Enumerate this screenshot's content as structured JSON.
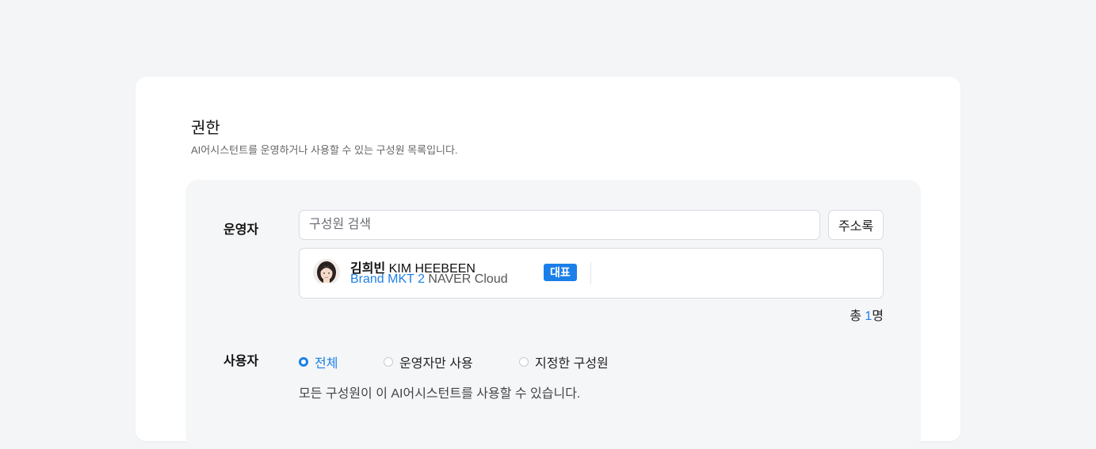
{
  "section": {
    "title": "권한",
    "description": "AI어시스턴트를 운영하거나 사용할 수 있는 구성원 목록입니다."
  },
  "operator": {
    "label": "운영자",
    "search_placeholder": "구성원 검색",
    "address_book_label": "주소록",
    "member": {
      "name_ko": "김희빈",
      "name_en": "KIM HEEBEEN",
      "team": "Brand MKT 2",
      "company": "NAVER Cloud",
      "badge": "대표"
    },
    "total_prefix": "총 ",
    "total_count": "1",
    "total_suffix": "명"
  },
  "user": {
    "label": "사용자",
    "options": [
      {
        "label": "전체",
        "selected": true
      },
      {
        "label": "운영자만 사용",
        "selected": false
      },
      {
        "label": "지정한 구성원",
        "selected": false
      }
    ],
    "description": "모든 구성원이 이 AI어시스턴트를 사용할 수 있습니다."
  },
  "colors": {
    "accent": "#1a7fe8",
    "background": "#f4f5f7",
    "panel": "#f5f6f8"
  },
  "icons": {
    "avatar": "user-avatar-photo",
    "radio": "radio-circle"
  }
}
